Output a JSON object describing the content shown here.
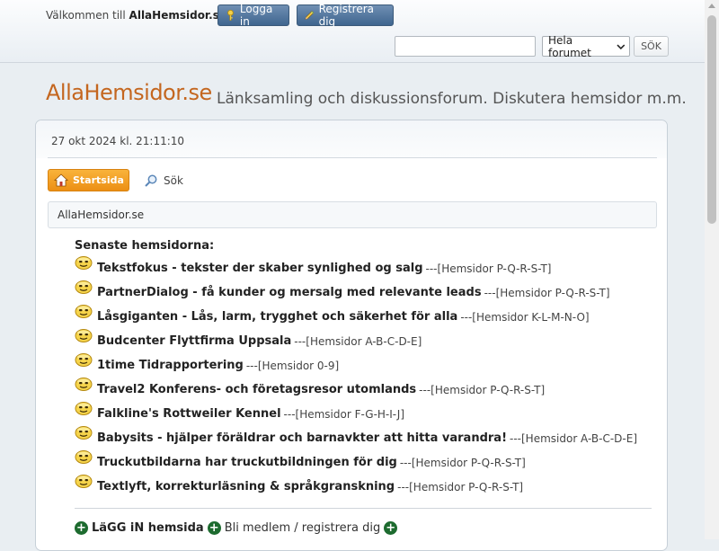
{
  "header": {
    "welcome_prefix": "Välkommen till",
    "welcome_site": "AllaHemsidor.se",
    "welcome_suffix": ".",
    "login_label": "Logga in",
    "register_label": "Registrera dig",
    "search_placeholder": "",
    "search_scope": "Hela forumet",
    "search_button": "SÖK"
  },
  "site": {
    "title": "AllaHemsidor.se",
    "tagline": "Länksamling och diskussionsforum. Diskutera hemsidor m.m."
  },
  "panel": {
    "datetime": "27 okt 2024 kl. 21:11:10",
    "home_tab": "Startsida",
    "search_link": "Sök",
    "breadcrumb": "AllaHemsidor.se",
    "latest_heading": "Senaste hemsidorna:"
  },
  "sites": [
    {
      "title": "Tekstfokus - tekster der skaber synlighed og salg",
      "category": "---[Hemsidor P-Q-R-S-T]"
    },
    {
      "title": "PartnerDialog - få kunder og mersalg med relevante leads",
      "category": "---[Hemsidor P-Q-R-S-T]"
    },
    {
      "title": "Låsgiganten - Lås, larm, trygghet och säkerhet för alla",
      "category": "---[Hemsidor K-L-M-N-O]"
    },
    {
      "title": "Budcenter Flyttfirma Uppsala",
      "category": "---[Hemsidor A-B-C-D-E]"
    },
    {
      "title": "1time Tidrapportering",
      "category": "---[Hemsidor 0-9]"
    },
    {
      "title": "Travel2 Konferens- och företagsresor utomlands",
      "category": "---[Hemsidor P-Q-R-S-T]"
    },
    {
      "title": "Falkline's Rottweiler Kennel",
      "category": "---[Hemsidor F-G-H-I-J]"
    },
    {
      "title": "Babysits - hjälper föräldrar och barnavkter att hitta varandra!",
      "category": "---[Hemsidor A-B-C-D-E]"
    },
    {
      "title": "Truckutbildarna har truckutbildningen för dig",
      "category": "---[Hemsidor P-Q-R-S-T]"
    },
    {
      "title": "Textlyft, korrekturläsning & språkgranskning",
      "category": "---[Hemsidor P-Q-R-S-T]"
    }
  ],
  "footer": {
    "add_site": "LäGG iN hemsida",
    "register": "Bli medlem / registrera dig"
  },
  "colors": {
    "title_orange": "#c4661f",
    "home_tab": "#ec8f14",
    "top_button": "#4f7299",
    "plus_green": "#1d6b2f"
  }
}
